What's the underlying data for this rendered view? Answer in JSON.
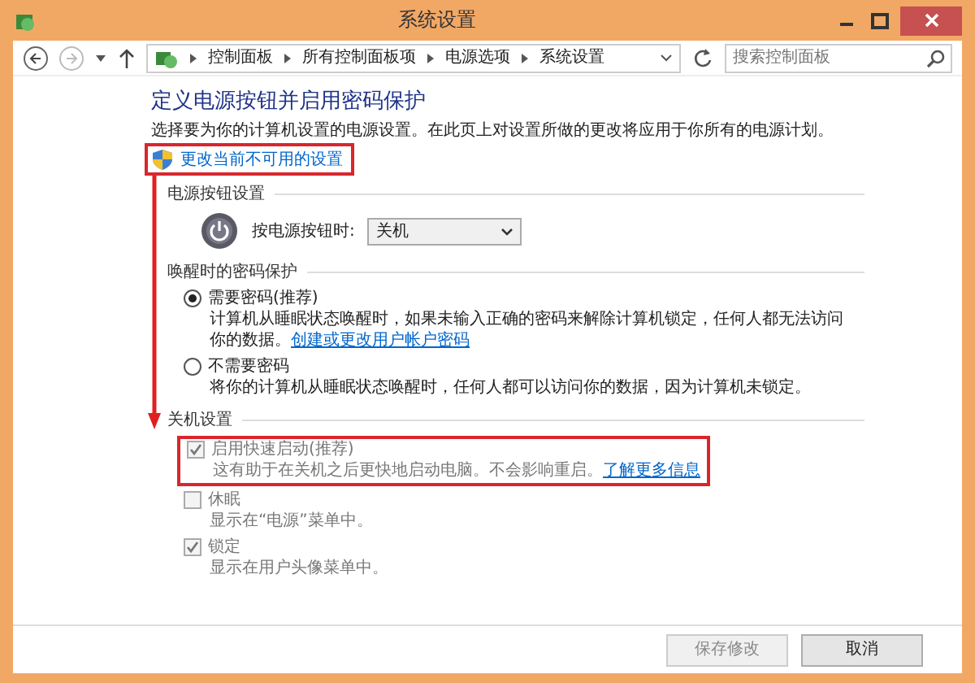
{
  "window": {
    "title": "系统设置"
  },
  "address_bar": {
    "path": [
      "控制面板",
      "所有控制面板项",
      "电源选项",
      "系统设置"
    ]
  },
  "search": {
    "placeholder": "搜索控制面板"
  },
  "heading": "定义电源按钮并启用密码保护",
  "intro": "选择要为你的计算机设置的电源设置。在此页上对设置所做的更改将应用于你所有的电源计划。",
  "change_link": {
    "label": "更改当前不可用的设置",
    "highlighted": true
  },
  "power_button": {
    "section": "电源按钮设置",
    "label": "按电源按钮时:",
    "value": "关机"
  },
  "password": {
    "section": "唤醒时的密码保护",
    "options": [
      {
        "label": "需要密码(推荐)",
        "selected": true,
        "description": "计算机从睡眠状态唤醒时，如果未输入正确的密码来解除计算机锁定，任何人都无法访问你的数据。",
        "link": "创建或更改用户帐户密码"
      },
      {
        "label": "不需要密码",
        "selected": false,
        "description": "将你的计算机从睡眠状态唤醒时，任何人都可以访问你的数据，因为计算机未锁定。"
      }
    ]
  },
  "shutdown": {
    "section": "关机设置",
    "options": [
      {
        "label": "启用快速启动(推荐)",
        "checked": true,
        "description": "这有助于在关机之后更快地启动电脑。不会影响重启。",
        "link": "了解更多信息",
        "highlighted": true
      },
      {
        "label": "休眠",
        "checked": false,
        "description": "显示在“电源”菜单中。"
      },
      {
        "label": "锁定",
        "checked": true,
        "description": "显示在用户头像菜单中。"
      }
    ]
  },
  "buttons": [
    {
      "label": "保存修改",
      "disabled": true
    },
    {
      "label": "取消",
      "disabled": false
    }
  ]
}
